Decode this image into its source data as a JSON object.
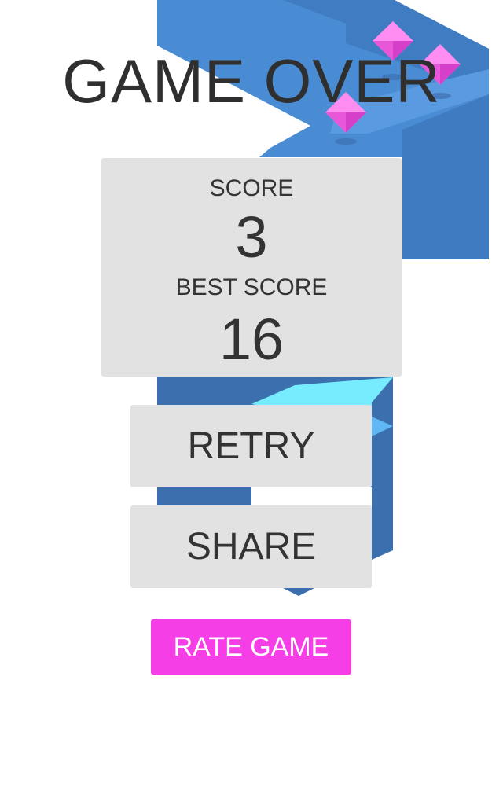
{
  "title": "GAME OVER",
  "score": {
    "label": "SCORE",
    "value": "3"
  },
  "best_score": {
    "label": "BEST SCORE",
    "value": "16"
  },
  "buttons": {
    "retry": "RETRY",
    "share": "SHARE",
    "rate": "RATE GAME"
  },
  "colors": {
    "path_top": "#4c8fd6",
    "path_side_dark": "#3a6fb0",
    "path_highlight": "#6ef0ff",
    "gem": "#f06ce6",
    "panel": "#e2e2e2",
    "rate_button": "#f53ee6",
    "text": "#2f2f2f"
  },
  "gems": [
    "gem-icon",
    "gem-icon",
    "gem-icon"
  ]
}
